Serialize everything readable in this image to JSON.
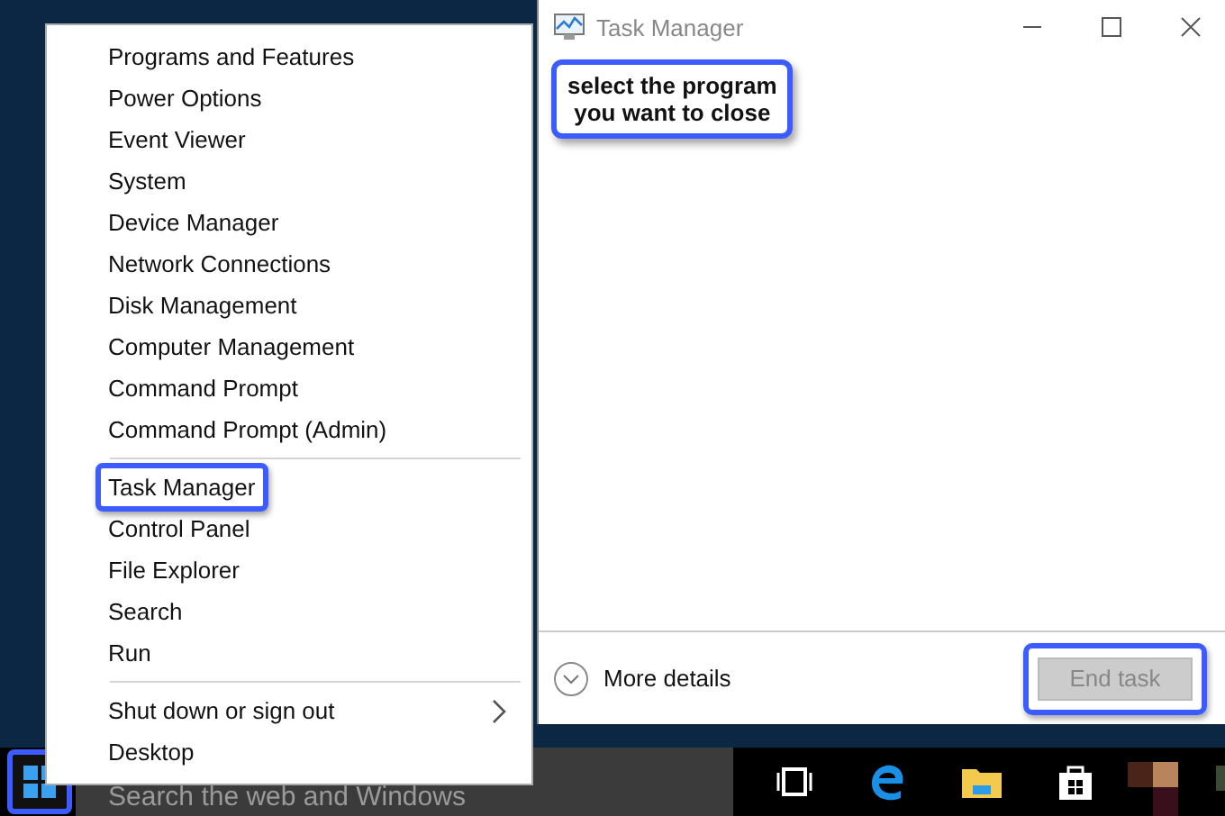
{
  "context_menu": {
    "groups": [
      {
        "items": [
          {
            "label": "Programs and Features",
            "highlighted": false,
            "submenu": false
          },
          {
            "label": "Power Options",
            "highlighted": false,
            "submenu": false
          },
          {
            "label": "Event Viewer",
            "highlighted": false,
            "submenu": false
          },
          {
            "label": "System",
            "highlighted": false,
            "submenu": false
          },
          {
            "label": "Device Manager",
            "highlighted": false,
            "submenu": false
          },
          {
            "label": "Network Connections",
            "highlighted": false,
            "submenu": false
          },
          {
            "label": "Disk Management",
            "highlighted": false,
            "submenu": false
          },
          {
            "label": "Computer Management",
            "highlighted": false,
            "submenu": false
          },
          {
            "label": "Command Prompt",
            "highlighted": false,
            "submenu": false
          },
          {
            "label": "Command Prompt (Admin)",
            "highlighted": false,
            "submenu": false
          }
        ]
      },
      {
        "items": [
          {
            "label": "Task Manager",
            "highlighted": true,
            "submenu": false
          },
          {
            "label": "Control Panel",
            "highlighted": false,
            "submenu": false
          },
          {
            "label": "File Explorer",
            "highlighted": false,
            "submenu": false
          },
          {
            "label": "Search",
            "highlighted": false,
            "submenu": false
          },
          {
            "label": "Run",
            "highlighted": false,
            "submenu": false
          }
        ]
      },
      {
        "items": [
          {
            "label": "Shut down or sign out",
            "highlighted": false,
            "submenu": true
          },
          {
            "label": "Desktop",
            "highlighted": false,
            "submenu": false
          }
        ]
      }
    ]
  },
  "task_manager": {
    "title": "Task Manager",
    "callout": "select the program\nyou want to close",
    "more_details": "More details",
    "end_task": {
      "label": "End task",
      "disabled": true,
      "highlighted": true
    }
  },
  "taskbar": {
    "start_highlighted": true,
    "search": {
      "placeholder": "Search the web and Windows"
    }
  }
}
